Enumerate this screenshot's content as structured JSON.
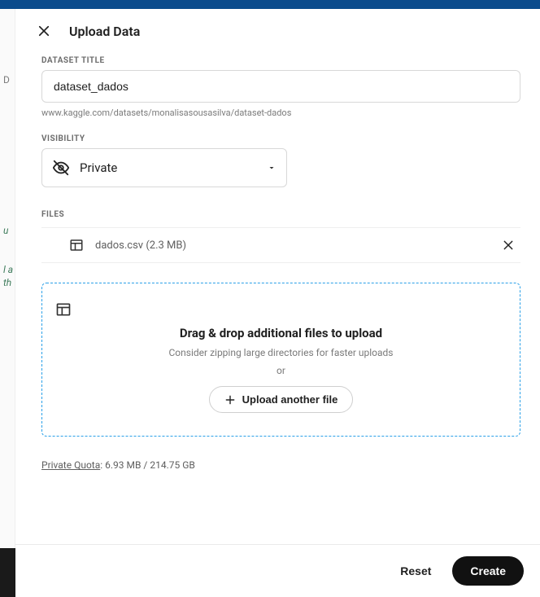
{
  "header": {
    "title": "Upload Data"
  },
  "dataset": {
    "title_label": "DATASET TITLE",
    "title_value": "dataset_dados",
    "url_hint": "www.kaggle.com/datasets/monalisasousasilva/dataset-dados"
  },
  "visibility": {
    "label": "VISIBILITY",
    "selected": "Private"
  },
  "files": {
    "label": "FILES",
    "items": [
      {
        "name": "dados.csv",
        "size": "(2.3 MB)"
      }
    ]
  },
  "dropzone": {
    "title": "Drag & drop additional files to upload",
    "subtitle": "Consider zipping large directories for faster uploads",
    "or": "or",
    "button": "Upload another file"
  },
  "quota": {
    "label": "Private Quota",
    "value": ": 6.93 MB / 214.75 GB"
  },
  "footer": {
    "reset": "Reset",
    "create": "Create"
  }
}
